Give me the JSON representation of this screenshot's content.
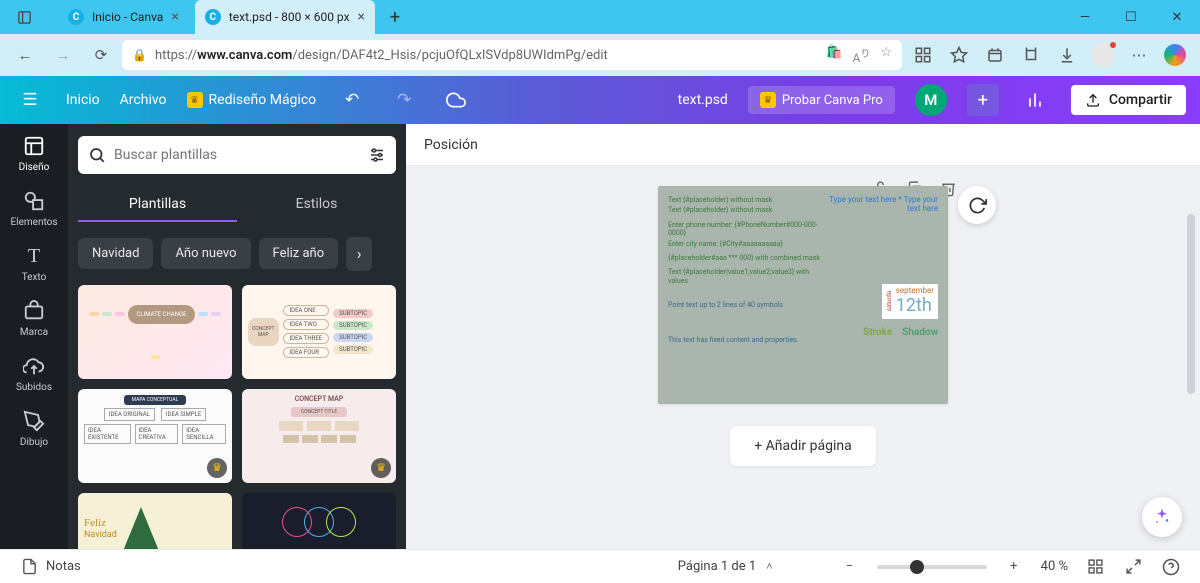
{
  "window": {
    "tabs": [
      {
        "title": "Inicio - Canva",
        "active": false
      },
      {
        "title": "text.psd - 800 × 600 px",
        "active": true
      }
    ],
    "url_display_prefix": "https://",
    "url_host": "www.canva.com",
    "url_path": "/design/DAF4t2_Hsis/pcjuOfQLxISVdp8UWIdmPg/edit"
  },
  "canva_header": {
    "home": "Inicio",
    "file": "Archivo",
    "magic": "Rediseño Mágico",
    "doc_title": "text.psd",
    "pro": "Probar Canva Pro",
    "user_initial": "M",
    "share": "Compartir"
  },
  "iconrail": [
    {
      "label": "Diseño",
      "active": true
    },
    {
      "label": "Elementos",
      "active": false
    },
    {
      "label": "Texto",
      "active": false
    },
    {
      "label": "Marca",
      "active": false
    },
    {
      "label": "Subidos",
      "active": false
    },
    {
      "label": "Dibujo",
      "active": false
    }
  ],
  "side_panel": {
    "search_placeholder": "Buscar plantillas",
    "tabs": [
      {
        "label": "Plantillas",
        "active": true
      },
      {
        "label": "Estilos",
        "active": false
      }
    ],
    "chips": [
      "Navidad",
      "Año nuevo",
      "Feliz año"
    ]
  },
  "context_bar": {
    "label": "Posición"
  },
  "canvas": {
    "text_lines": [
      "Text {#placeholder} without mask",
      "Text {#placeholder} without mask",
      "Enter phone number: {#PhoneNumber#000-000-0000}",
      "Enter city name: {#City#aaaaaaaaaa}",
      "{#placeholder#aaa *** 000} with combined mask",
      "Text {#placeholder|value1;value2;value3} with values",
      "Point text up to 2 lines of 40 symbols"
    ],
    "type_here": "Type your text here * Type your text here",
    "calendar": {
      "weekday": "saturda",
      "month": "september",
      "day": "12th"
    },
    "stroke": "Stroke",
    "shadow": "Shadow",
    "footer_note": "This text has fixed content and properties.",
    "add_page": "+ Añadir página"
  },
  "bottom": {
    "notes": "Notas",
    "page_label": "Página 1 de 1",
    "zoom": "40 %"
  }
}
